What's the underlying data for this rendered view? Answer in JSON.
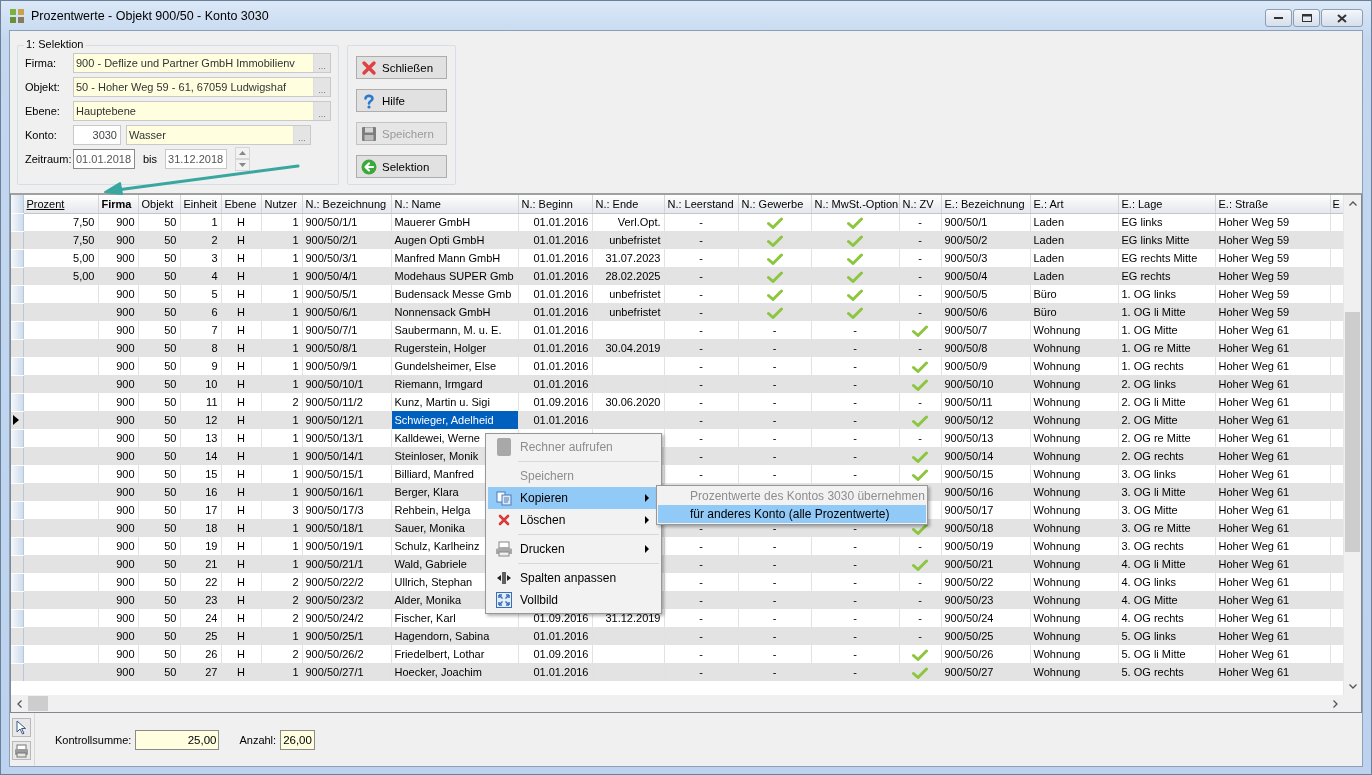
{
  "window": {
    "title": "Prozentwerte - Objekt 900/50 - Konto 3030"
  },
  "selection": {
    "title": "1: Selektion",
    "fields": [
      {
        "label": "Firma:",
        "value": "900 - Deflize und Partner GmbH Immobilienv",
        "button": "..."
      },
      {
        "label": "Objekt:",
        "value": "50 - Hoher Weg 59 - 61, 67059 Ludwigshaf",
        "button": "..."
      },
      {
        "label": "Ebene:",
        "value": "Hauptebene",
        "button": "..."
      }
    ],
    "konto": {
      "label": "Konto:",
      "number": "3030",
      "name": "Wasser",
      "button": "..."
    },
    "period": {
      "label": "Zeitraum:",
      "from": "01.01.2018",
      "separator": "bis",
      "to": "31.12.2018"
    }
  },
  "buttons": [
    {
      "label": "Schließen",
      "disabled": false
    },
    {
      "label": "Hilfe",
      "disabled": false
    },
    {
      "label": "Speichern",
      "disabled": true
    },
    {
      "label": "Selektion",
      "disabled": false
    }
  ],
  "table": {
    "columns": [
      {
        "label": "Prozent",
        "underlined": true,
        "bold": false
      },
      {
        "label": "Firma",
        "underlined": false,
        "bold": true
      },
      {
        "label": "Objekt",
        "underlined": false,
        "bold": false
      },
      {
        "label": "Einheit",
        "underlined": false,
        "bold": false
      },
      {
        "label": "Ebene",
        "underlined": false,
        "bold": false
      },
      {
        "label": "Nutzer",
        "underlined": false,
        "bold": false
      },
      {
        "label": "N.: Bezeichnung",
        "underlined": false,
        "bold": false
      },
      {
        "label": "N.: Name",
        "underlined": false,
        "bold": false
      },
      {
        "label": "N.: Beginn",
        "underlined": false,
        "bold": false
      },
      {
        "label": "N.: Ende",
        "underlined": false,
        "bold": false
      },
      {
        "label": "N.: Leerstand",
        "underlined": false,
        "bold": false
      },
      {
        "label": "N.: Gewerbe",
        "underlined": false,
        "bold": false
      },
      {
        "label": "N.: MwSt.-Option",
        "underlined": false,
        "bold": false
      },
      {
        "label": "N.: ZV",
        "underlined": false,
        "bold": false
      },
      {
        "label": "E.: Bezeichnung",
        "underlined": false,
        "bold": false
      },
      {
        "label": "E.: Art",
        "underlined": false,
        "bold": false
      },
      {
        "label": "E.: Lage",
        "underlined": false,
        "bold": false
      },
      {
        "label": "E.: Straße",
        "underlined": false,
        "bold": false
      },
      {
        "label": "E",
        "underlined": false,
        "bold": false
      }
    ],
    "rows": [
      {
        "selected": false,
        "cells": [
          "7,50",
          "900",
          "50",
          "1",
          "H",
          "1",
          "900/50/1/1",
          "Mauerer GmbH",
          "01.01.2016",
          "Verl.Opt.",
          "-",
          true,
          true,
          "-",
          "900/50/1",
          "Laden",
          "EG links",
          "Hoher Weg 59"
        ]
      },
      {
        "selected": false,
        "cells": [
          "7,50",
          "900",
          "50",
          "2",
          "H",
          "1",
          "900/50/2/1",
          "Augen Opti GmbH",
          "01.01.2016",
          "unbefristet",
          "-",
          true,
          true,
          "-",
          "900/50/2",
          "Laden",
          "EG links Mitte",
          "Hoher Weg 59"
        ]
      },
      {
        "selected": false,
        "cells": [
          "5,00",
          "900",
          "50",
          "3",
          "H",
          "1",
          "900/50/3/1",
          "Manfred Mann GmbH",
          "01.01.2016",
          "31.07.2023",
          "-",
          true,
          true,
          "-",
          "900/50/3",
          "Laden",
          "EG rechts Mitte",
          "Hoher Weg 59"
        ]
      },
      {
        "selected": false,
        "cells": [
          "5,00",
          "900",
          "50",
          "4",
          "H",
          "1",
          "900/50/4/1",
          "Modehaus SUPER Gmb",
          "01.01.2016",
          "28.02.2025",
          "-",
          true,
          true,
          "-",
          "900/50/4",
          "Laden",
          "EG rechts",
          "Hoher Weg 59"
        ]
      },
      {
        "selected": false,
        "cells": [
          null,
          "900",
          "50",
          "5",
          "H",
          "1",
          "900/50/5/1",
          "Budensack Messe Gmb",
          "01.01.2016",
          "unbefristet",
          "-",
          true,
          true,
          "-",
          "900/50/5",
          "Büro",
          "1. OG links",
          "Hoher Weg 59"
        ]
      },
      {
        "selected": false,
        "cells": [
          null,
          "900",
          "50",
          "6",
          "H",
          "1",
          "900/50/6/1",
          "Nonnensack GmbH",
          "01.01.2016",
          "unbefristet",
          "-",
          true,
          true,
          "-",
          "900/50/6",
          "Büro",
          "1. OG li Mitte",
          "Hoher Weg 59"
        ]
      },
      {
        "selected": false,
        "cells": [
          null,
          "900",
          "50",
          "7",
          "H",
          "1",
          "900/50/7/1",
          "Saubermann, M. u. E.",
          "01.01.2016",
          null,
          "-",
          "-",
          "-",
          true,
          "900/50/7",
          "Wohnung",
          "1. OG Mitte",
          "Hoher Weg 61"
        ]
      },
      {
        "selected": false,
        "cells": [
          null,
          "900",
          "50",
          "8",
          "H",
          "1",
          "900/50/8/1",
          "Rugerstein, Holger",
          "01.01.2016",
          "30.04.2019",
          "-",
          "-",
          "-",
          "-",
          "900/50/8",
          "Wohnung",
          "1. OG re Mitte",
          "Hoher Weg 61"
        ]
      },
      {
        "selected": false,
        "cells": [
          null,
          "900",
          "50",
          "9",
          "H",
          "1",
          "900/50/9/1",
          "Gundelsheimer, Else",
          "01.01.2016",
          null,
          "-",
          "-",
          "-",
          true,
          "900/50/9",
          "Wohnung",
          "1. OG rechts",
          "Hoher Weg 61"
        ]
      },
      {
        "selected": false,
        "cells": [
          null,
          "900",
          "50",
          "10",
          "H",
          "1",
          "900/50/10/1",
          "Riemann, Irmgard",
          "01.01.2016",
          null,
          "-",
          "-",
          "-",
          true,
          "900/50/10",
          "Wohnung",
          "2. OG links",
          "Hoher Weg 61"
        ]
      },
      {
        "selected": false,
        "cells": [
          null,
          "900",
          "50",
          "11",
          "H",
          "2",
          "900/50/11/2",
          "Kunz, Martin u. Sigi",
          "01.09.2016",
          "30.06.2020",
          "-",
          "-",
          "-",
          "-",
          "900/50/11",
          "Wohnung",
          "2. OG li Mitte",
          "Hoher Weg 61"
        ]
      },
      {
        "selected": true,
        "cells": [
          null,
          "900",
          "50",
          "12",
          "H",
          "1",
          "900/50/12/1",
          "Schwieger, Adelheid",
          "01.01.2016",
          null,
          "-",
          "-",
          "-",
          true,
          "900/50/12",
          "Wohnung",
          "2. OG Mitte",
          "Hoher Weg 61"
        ]
      },
      {
        "selected": false,
        "cells": [
          null,
          "900",
          "50",
          "13",
          "H",
          "1",
          "900/50/13/1",
          "Kalldewei, Werne",
          null,
          null,
          "-",
          "-",
          "-",
          "-",
          "900/50/13",
          "Wohnung",
          "2. OG re Mitte",
          "Hoher Weg 61"
        ]
      },
      {
        "selected": false,
        "cells": [
          null,
          "900",
          "50",
          "14",
          "H",
          "1",
          "900/50/14/1",
          "Steinloser, Monik",
          null,
          null,
          "-",
          "-",
          "-",
          true,
          "900/50/14",
          "Wohnung",
          "2. OG rechts",
          "Hoher Weg 61"
        ]
      },
      {
        "selected": false,
        "cells": [
          null,
          "900",
          "50",
          "15",
          "H",
          "1",
          "900/50/15/1",
          "Billiard, Manfred",
          null,
          null,
          "-",
          "-",
          "-",
          true,
          "900/50/15",
          "Wohnung",
          "3. OG links",
          "Hoher Weg 61"
        ]
      },
      {
        "selected": false,
        "cells": [
          null,
          "900",
          "50",
          "16",
          "H",
          "1",
          "900/50/16/1",
          "Berger, Klara",
          null,
          null,
          null,
          null,
          null,
          null,
          "900/50/16",
          "Wohnung",
          "3. OG li Mitte",
          "Hoher Weg 61"
        ]
      },
      {
        "selected": false,
        "cells": [
          null,
          "900",
          "50",
          "17",
          "H",
          "3",
          "900/50/17/3",
          "Rehbein, Helga",
          null,
          null,
          null,
          null,
          null,
          null,
          "900/50/17",
          "Wohnung",
          "3. OG Mitte",
          "Hoher Weg 61"
        ]
      },
      {
        "selected": false,
        "cells": [
          null,
          "900",
          "50",
          "18",
          "H",
          "1",
          "900/50/18/1",
          "Sauer, Monika",
          null,
          null,
          "-",
          "-",
          "-",
          true,
          "900/50/18",
          "Wohnung",
          "3. OG re Mitte",
          "Hoher Weg 61"
        ]
      },
      {
        "selected": false,
        "cells": [
          null,
          "900",
          "50",
          "19",
          "H",
          "1",
          "900/50/19/1",
          "Schulz, Karlheinz",
          null,
          null,
          "-",
          "-",
          "-",
          "-",
          "900/50/19",
          "Wohnung",
          "3. OG rechts",
          "Hoher Weg 61"
        ]
      },
      {
        "selected": false,
        "cells": [
          null,
          "900",
          "50",
          "21",
          "H",
          "1",
          "900/50/21/1",
          "Wald, Gabriele",
          null,
          null,
          "-",
          "-",
          "-",
          true,
          "900/50/21",
          "Wohnung",
          "4. OG li Mitte",
          "Hoher Weg 61"
        ]
      },
      {
        "selected": false,
        "cells": [
          null,
          "900",
          "50",
          "22",
          "H",
          "2",
          "900/50/22/2",
          "Ullrich, Stephan",
          null,
          null,
          "-",
          "-",
          "-",
          "-",
          "900/50/22",
          "Wohnung",
          "4. OG links",
          "Hoher Weg 61"
        ]
      },
      {
        "selected": false,
        "cells": [
          null,
          "900",
          "50",
          "23",
          "H",
          "2",
          "900/50/23/2",
          "Alder, Monika",
          null,
          null,
          "-",
          "-",
          "-",
          "-",
          "900/50/23",
          "Wohnung",
          "4. OG Mitte",
          "Hoher Weg 61"
        ]
      },
      {
        "selected": false,
        "cells": [
          null,
          "900",
          "50",
          "24",
          "H",
          "2",
          "900/50/24/2",
          "Fischer, Karl",
          "01.09.2016",
          "31.12.2019",
          "-",
          "-",
          "-",
          "-",
          "900/50/24",
          "Wohnung",
          "4. OG rechts",
          "Hoher Weg 61"
        ]
      },
      {
        "selected": false,
        "cells": [
          null,
          "900",
          "50",
          "25",
          "H",
          "1",
          "900/50/25/1",
          "Hagendorn, Sabina",
          "01.01.2016",
          null,
          "-",
          "-",
          "-",
          "-",
          "900/50/25",
          "Wohnung",
          "5. OG links",
          "Hoher Weg 61"
        ]
      },
      {
        "selected": false,
        "cells": [
          null,
          "900",
          "50",
          "26",
          "H",
          "2",
          "900/50/26/2",
          "Friedelbert, Lothar",
          "01.09.2016",
          null,
          "-",
          "-",
          "-",
          true,
          "900/50/26",
          "Wohnung",
          "5. OG li Mitte",
          "Hoher Weg 61"
        ]
      },
      {
        "selected": false,
        "cells": [
          null,
          "900",
          "50",
          "27",
          "H",
          "1",
          "900/50/27/1",
          "Hoecker, Joachim",
          "01.01.2016",
          null,
          "-",
          "-",
          "-",
          true,
          "900/50/27",
          "Wohnung",
          "5. OG rechts",
          "Hoher Weg 61"
        ]
      }
    ]
  },
  "context_menu": {
    "items": [
      {
        "kind": "item",
        "label": "Rechner aufrufen",
        "disabled": true,
        "selected": false,
        "submenu": false
      },
      {
        "kind": "separator"
      },
      {
        "kind": "item",
        "label": "Speichern",
        "disabled": true,
        "selected": false,
        "submenu": false
      },
      {
        "kind": "item",
        "label": "Kopieren",
        "disabled": false,
        "selected": true,
        "submenu": true
      },
      {
        "kind": "item",
        "label": "Löschen",
        "disabled": false,
        "selected": false,
        "submenu": true
      },
      {
        "kind": "separator"
      },
      {
        "kind": "item",
        "label": "Drucken",
        "disabled": false,
        "selected": false,
        "submenu": true
      },
      {
        "kind": "separator"
      },
      {
        "kind": "item",
        "label": "Spalten anpassen",
        "disabled": false,
        "selected": false,
        "submenu": false
      },
      {
        "kind": "item",
        "label": "Vollbild",
        "disabled": false,
        "selected": false,
        "submenu": false
      }
    ]
  },
  "submenu": {
    "items": [
      {
        "label": "Prozentwerte des Kontos 3030 übernehmen",
        "disabled": true,
        "selected": false
      },
      {
        "label": "für anderes Konto (alle Prozentwerte)",
        "disabled": false,
        "selected": true
      }
    ]
  },
  "footer": {
    "fields": [
      {
        "label": "Kontrollsumme:",
        "value": "25,00"
      },
      {
        "label": "Anzahl:",
        "value": "26,00"
      }
    ]
  }
}
